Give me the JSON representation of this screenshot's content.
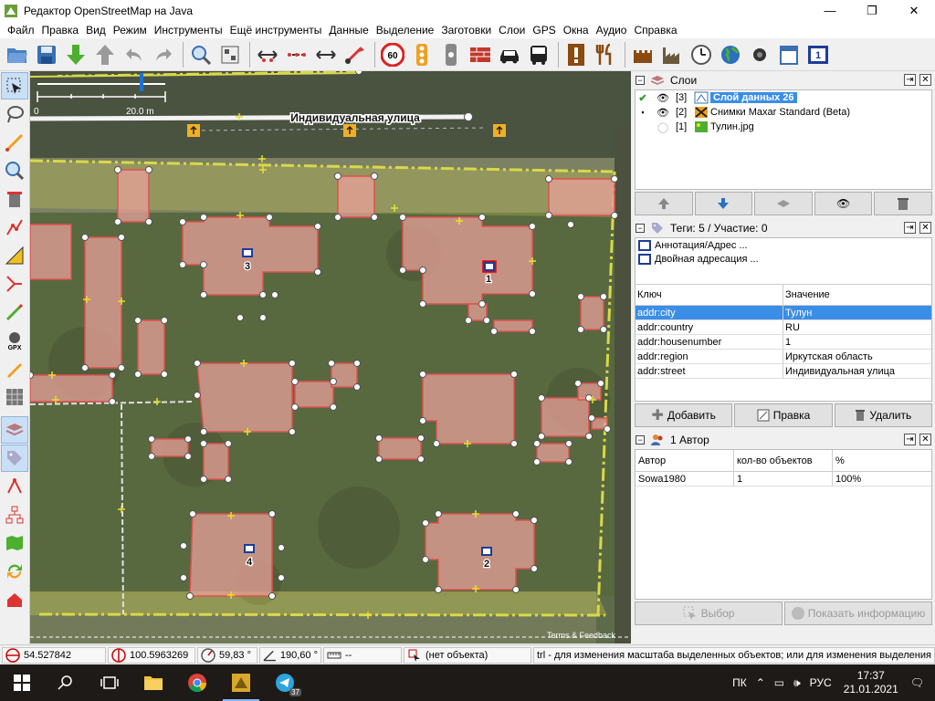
{
  "window": {
    "title": "Редактор OpenStreetMap на Java",
    "minimize": "—",
    "maximize": "❐",
    "close": "✕"
  },
  "menu": [
    "Файл",
    "Правка",
    "Вид",
    "Режим",
    "Инструменты",
    "Ещё инструменты",
    "Данные",
    "Выделение",
    "Заготовки",
    "Слои",
    "GPS",
    "Окна",
    "Аудио",
    "Справка"
  ],
  "toolbar": {
    "icons": [
      "open-icon",
      "save-icon",
      "download-icon",
      "upload-icon",
      "undo-icon",
      "redo-icon",
      "zoom-icon",
      "preferences-icon",
      "align-horizontal-icon",
      "distribute-icon",
      "mirror-icon",
      "move-node-icon",
      "speed-limit-icon",
      "traffic-light-icon",
      "crossing-icon",
      "barrier-icon",
      "car-icon",
      "bus-icon",
      "warning-icon",
      "restaurant-icon",
      "castle-icon",
      "industrial-icon",
      "clock-icon",
      "globe-icon",
      "puzzle-icon",
      "calendar-icon",
      "address-icon"
    ],
    "speed_limit_text": "60",
    "address_icon_text": "1"
  },
  "left_tools": [
    "select-icon",
    "lasso-icon",
    "draw-icon",
    "zoom-tool-icon",
    "delete-icon",
    "parallel-icon",
    "measure-icon",
    "split-icon",
    "paint-icon",
    "gpx-icon",
    "edit-icon",
    "grid-icon",
    "layers-tool-icon",
    "tag-tool-icon",
    "relation-icon",
    "hierarchy-icon",
    "map-icon",
    "refresh-icon",
    "home-icon"
  ],
  "map": {
    "scale_label": "20.0 m",
    "scale_zero": "0",
    "street_name": "Индивидуальная улица",
    "attribution": "Terms & Feedback",
    "house_numbers": [
      "1",
      "2",
      "3",
      "4"
    ]
  },
  "layers_panel": {
    "title": "Слои",
    "layers": [
      {
        "index": "[3]",
        "name": "Слой данных 26",
        "selected": true
      },
      {
        "index": "[2]",
        "name": "Снимки Maxar Standard (Beta)",
        "selected": false
      },
      {
        "index": "[1]",
        "name": "Тулин.jpg",
        "selected": false
      }
    ]
  },
  "tags_panel": {
    "title": "Теги: 5 / Участие: 0",
    "presets": [
      "Аннотация/Адрес ...",
      "Двойная адресация ..."
    ],
    "col_key": "Ключ",
    "col_value": "Значение",
    "rows": [
      {
        "key": "addr:city",
        "value": "Тулун",
        "selected": true
      },
      {
        "key": "addr:country",
        "value": "RU",
        "selected": false
      },
      {
        "key": "addr:housenumber",
        "value": "1",
        "selected": false
      },
      {
        "key": "addr:region",
        "value": "Иркутская область",
        "selected": false
      },
      {
        "key": "addr:street",
        "value": "Индивидуальная улица",
        "selected": false
      }
    ],
    "btn_add": "Добавить",
    "btn_edit": "Правка",
    "btn_delete": "Удалить"
  },
  "authors_panel": {
    "title": "1 Автор",
    "col_author": "Автор",
    "col_count": "кол-во объектов",
    "col_percent": "%",
    "rows": [
      {
        "author": "Sowa1980",
        "count": "1",
        "percent": "100%"
      }
    ],
    "btn_select": "Выбор",
    "btn_info": "Показать информацию"
  },
  "statusbar": {
    "lat": "54.527842",
    "lon": "100.5963269",
    "heading": "59,83 °",
    "angle": "190,60 °",
    "length": "--",
    "object": "(нет объекта)",
    "help": "trl - для изменения масштаба выделенных объектов; или для изменения выделения"
  },
  "taskbar": {
    "lang_short": "ПК",
    "lang": "РУС",
    "time": "17:37",
    "date": "21.01.2021",
    "telegram_badge": "37"
  },
  "colors": {
    "building_fill": "#e8a09a",
    "building_stroke": "#e05050",
    "road": "#f2f2f2",
    "boundary": "#e8e84a",
    "selected_blue": "#3a8ee6"
  }
}
